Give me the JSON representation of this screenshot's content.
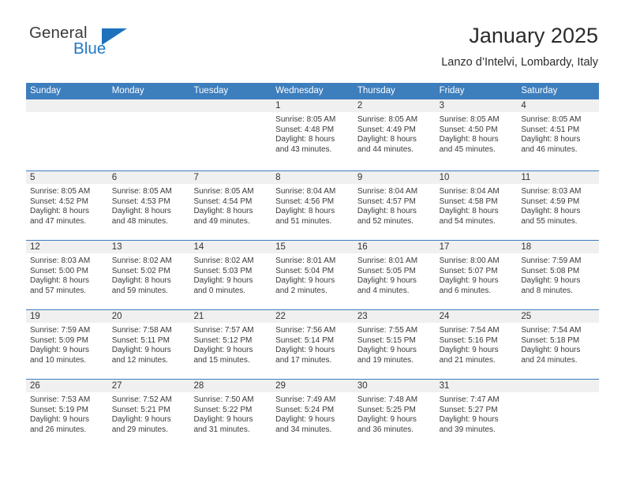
{
  "logo": {
    "word_top": "General",
    "word_bottom": "Blue",
    "triangle_color": "#1e72bc",
    "text_color": "#3b3b3b",
    "blue_color": "#2079c4"
  },
  "header": {
    "title": "January 2025",
    "subtitle": "Lanzo d’Intelvi, Lombardy, Italy"
  },
  "calendar": {
    "header_bg": "#3d7ebd",
    "daycell_header_bg": "#f0f0f0",
    "weekdays": [
      "Sunday",
      "Monday",
      "Tuesday",
      "Wednesday",
      "Thursday",
      "Friday",
      "Saturday"
    ],
    "weeks": [
      [
        {
          "day": "",
          "lines": []
        },
        {
          "day": "",
          "lines": []
        },
        {
          "day": "",
          "lines": []
        },
        {
          "day": "1",
          "lines": [
            "Sunrise: 8:05 AM",
            "Sunset: 4:48 PM",
            "Daylight: 8 hours",
            "and 43 minutes."
          ]
        },
        {
          "day": "2",
          "lines": [
            "Sunrise: 8:05 AM",
            "Sunset: 4:49 PM",
            "Daylight: 8 hours",
            "and 44 minutes."
          ]
        },
        {
          "day": "3",
          "lines": [
            "Sunrise: 8:05 AM",
            "Sunset: 4:50 PM",
            "Daylight: 8 hours",
            "and 45 minutes."
          ]
        },
        {
          "day": "4",
          "lines": [
            "Sunrise: 8:05 AM",
            "Sunset: 4:51 PM",
            "Daylight: 8 hours",
            "and 46 minutes."
          ]
        }
      ],
      [
        {
          "day": "5",
          "lines": [
            "Sunrise: 8:05 AM",
            "Sunset: 4:52 PM",
            "Daylight: 8 hours",
            "and 47 minutes."
          ]
        },
        {
          "day": "6",
          "lines": [
            "Sunrise: 8:05 AM",
            "Sunset: 4:53 PM",
            "Daylight: 8 hours",
            "and 48 minutes."
          ]
        },
        {
          "day": "7",
          "lines": [
            "Sunrise: 8:05 AM",
            "Sunset: 4:54 PM",
            "Daylight: 8 hours",
            "and 49 minutes."
          ]
        },
        {
          "day": "8",
          "lines": [
            "Sunrise: 8:04 AM",
            "Sunset: 4:56 PM",
            "Daylight: 8 hours",
            "and 51 minutes."
          ]
        },
        {
          "day": "9",
          "lines": [
            "Sunrise: 8:04 AM",
            "Sunset: 4:57 PM",
            "Daylight: 8 hours",
            "and 52 minutes."
          ]
        },
        {
          "day": "10",
          "lines": [
            "Sunrise: 8:04 AM",
            "Sunset: 4:58 PM",
            "Daylight: 8 hours",
            "and 54 minutes."
          ]
        },
        {
          "day": "11",
          "lines": [
            "Sunrise: 8:03 AM",
            "Sunset: 4:59 PM",
            "Daylight: 8 hours",
            "and 55 minutes."
          ]
        }
      ],
      [
        {
          "day": "12",
          "lines": [
            "Sunrise: 8:03 AM",
            "Sunset: 5:00 PM",
            "Daylight: 8 hours",
            "and 57 minutes."
          ]
        },
        {
          "day": "13",
          "lines": [
            "Sunrise: 8:02 AM",
            "Sunset: 5:02 PM",
            "Daylight: 8 hours",
            "and 59 minutes."
          ]
        },
        {
          "day": "14",
          "lines": [
            "Sunrise: 8:02 AM",
            "Sunset: 5:03 PM",
            "Daylight: 9 hours",
            "and 0 minutes."
          ]
        },
        {
          "day": "15",
          "lines": [
            "Sunrise: 8:01 AM",
            "Sunset: 5:04 PM",
            "Daylight: 9 hours",
            "and 2 minutes."
          ]
        },
        {
          "day": "16",
          "lines": [
            "Sunrise: 8:01 AM",
            "Sunset: 5:05 PM",
            "Daylight: 9 hours",
            "and 4 minutes."
          ]
        },
        {
          "day": "17",
          "lines": [
            "Sunrise: 8:00 AM",
            "Sunset: 5:07 PM",
            "Daylight: 9 hours",
            "and 6 minutes."
          ]
        },
        {
          "day": "18",
          "lines": [
            "Sunrise: 7:59 AM",
            "Sunset: 5:08 PM",
            "Daylight: 9 hours",
            "and 8 minutes."
          ]
        }
      ],
      [
        {
          "day": "19",
          "lines": [
            "Sunrise: 7:59 AM",
            "Sunset: 5:09 PM",
            "Daylight: 9 hours",
            "and 10 minutes."
          ]
        },
        {
          "day": "20",
          "lines": [
            "Sunrise: 7:58 AM",
            "Sunset: 5:11 PM",
            "Daylight: 9 hours",
            "and 12 minutes."
          ]
        },
        {
          "day": "21",
          "lines": [
            "Sunrise: 7:57 AM",
            "Sunset: 5:12 PM",
            "Daylight: 9 hours",
            "and 15 minutes."
          ]
        },
        {
          "day": "22",
          "lines": [
            "Sunrise: 7:56 AM",
            "Sunset: 5:14 PM",
            "Daylight: 9 hours",
            "and 17 minutes."
          ]
        },
        {
          "day": "23",
          "lines": [
            "Sunrise: 7:55 AM",
            "Sunset: 5:15 PM",
            "Daylight: 9 hours",
            "and 19 minutes."
          ]
        },
        {
          "day": "24",
          "lines": [
            "Sunrise: 7:54 AM",
            "Sunset: 5:16 PM",
            "Daylight: 9 hours",
            "and 21 minutes."
          ]
        },
        {
          "day": "25",
          "lines": [
            "Sunrise: 7:54 AM",
            "Sunset: 5:18 PM",
            "Daylight: 9 hours",
            "and 24 minutes."
          ]
        }
      ],
      [
        {
          "day": "26",
          "lines": [
            "Sunrise: 7:53 AM",
            "Sunset: 5:19 PM",
            "Daylight: 9 hours",
            "and 26 minutes."
          ]
        },
        {
          "day": "27",
          "lines": [
            "Sunrise: 7:52 AM",
            "Sunset: 5:21 PM",
            "Daylight: 9 hours",
            "and 29 minutes."
          ]
        },
        {
          "day": "28",
          "lines": [
            "Sunrise: 7:50 AM",
            "Sunset: 5:22 PM",
            "Daylight: 9 hours",
            "and 31 minutes."
          ]
        },
        {
          "day": "29",
          "lines": [
            "Sunrise: 7:49 AM",
            "Sunset: 5:24 PM",
            "Daylight: 9 hours",
            "and 34 minutes."
          ]
        },
        {
          "day": "30",
          "lines": [
            "Sunrise: 7:48 AM",
            "Sunset: 5:25 PM",
            "Daylight: 9 hours",
            "and 36 minutes."
          ]
        },
        {
          "day": "31",
          "lines": [
            "Sunrise: 7:47 AM",
            "Sunset: 5:27 PM",
            "Daylight: 9 hours",
            "and 39 minutes."
          ]
        },
        {
          "day": "",
          "lines": []
        }
      ]
    ]
  }
}
